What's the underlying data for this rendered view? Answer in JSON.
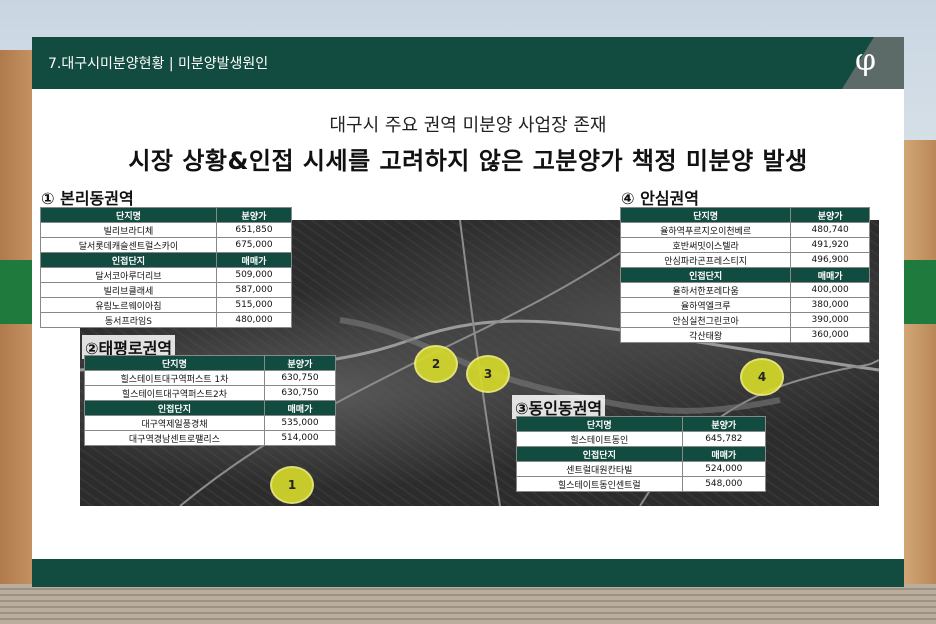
{
  "header": {
    "title": "7.대구시미분양현황 | 미분양발생원인",
    "logo": "φ"
  },
  "subtitle": "대구시 주요 권역 미분양 사업장 존재",
  "headline": "시장 상황&인접 시세를 고려하지 않은 고분양가 책정 미분양 발생",
  "colors": {
    "brand": "#124b3f",
    "marker": "#d7dc2a"
  },
  "regions": {
    "r1": {
      "title": "① 본리동권역",
      "head1": [
        "단지명",
        "분양가"
      ],
      "rows1": [
        [
          "빌리브라디체",
          "651,850"
        ],
        [
          "달서롯데캐슬센트럴스카이",
          "675,000"
        ]
      ],
      "head2": [
        "인접단지",
        "매매가"
      ],
      "rows2": [
        [
          "달서코아루더리브",
          "509,000"
        ],
        [
          "빌리브클래세",
          "587,000"
        ],
        [
          "유림노르웨이아침",
          "515,000"
        ],
        [
          "동서프라임S",
          "480,000"
        ]
      ]
    },
    "r2": {
      "title": "②태평로권역",
      "head1": [
        "단지명",
        "분양가"
      ],
      "rows1": [
        [
          "힐스테이트대구역퍼스트 1차",
          "630,750"
        ],
        [
          "힐스테이트대구역퍼스트2차",
          "630,750"
        ]
      ],
      "head2": [
        "인접단지",
        "매매가"
      ],
      "rows2": [
        [
          "대구역제일풍경채",
          "535,000"
        ],
        [
          "대구역경남센트로팰리스",
          "514,000"
        ]
      ]
    },
    "r3": {
      "title": "③동인동권역",
      "head1": [
        "단지명",
        "분양가"
      ],
      "rows1": [
        [
          "힐스테이트동인",
          "645,782"
        ]
      ],
      "head2": [
        "인접단지",
        "매매가"
      ],
      "rows2": [
        [
          "센트럴대원칸타빌",
          "524,000"
        ],
        [
          "힐스테이트동인센트럴",
          "548,000"
        ]
      ]
    },
    "r4": {
      "title": "④ 안심권역",
      "head1": [
        "단지명",
        "분양가"
      ],
      "rows1": [
        [
          "율하역푸르지오이천베르",
          "480,740"
        ],
        [
          "호반써밋이스텔라",
          "491,920"
        ],
        [
          "안심파라곤프레스티지",
          "496,900"
        ]
      ],
      "head2": [
        "인접단지",
        "매매가"
      ],
      "rows2": [
        [
          "율하서한포레다움",
          "400,000"
        ],
        [
          "율하역엘크루",
          "380,000"
        ],
        [
          "안심실천그린코아",
          "390,000"
        ],
        [
          "각산태왕",
          "360,000"
        ]
      ]
    }
  },
  "markers": [
    "1",
    "2",
    "3",
    "4"
  ]
}
